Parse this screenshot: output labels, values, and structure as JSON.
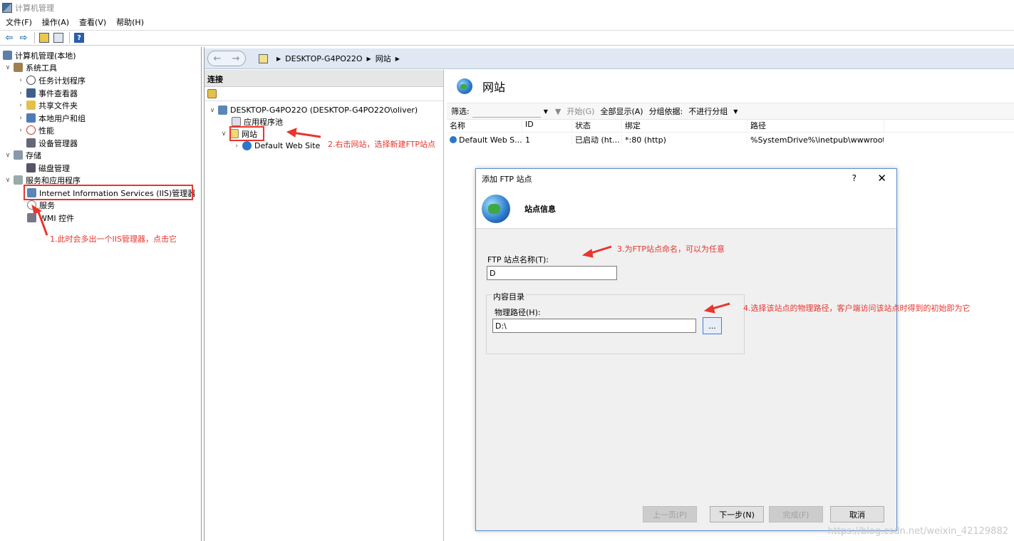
{
  "window": {
    "title": "计算机管理"
  },
  "menu": [
    "文件(F)",
    "操作(A)",
    "查看(V)",
    "帮助(H)"
  ],
  "left_tree": {
    "root": "计算机管理(本地)",
    "system_tools": "系统工具",
    "task_scheduler": "任务计划程序",
    "event_viewer": "事件查看器",
    "shared_folders": "共享文件夹",
    "local_users": "本地用户和组",
    "performance": "性能",
    "device_manager": "设备管理器",
    "storage": "存储",
    "disk_mgmt": "磁盘管理",
    "services_apps": "服务和应用程序",
    "iis_manager": "Internet Information Services (IIS)管理器",
    "services": "服务",
    "wmi": "WMI 控件"
  },
  "address": {
    "host": "DESKTOP-G4PO22O",
    "node": "网站"
  },
  "connections": {
    "title": "连接",
    "server": "DESKTOP-G4PO22O (DESKTOP-G4PO22O\\oliver)",
    "app_pools": "应用程序池",
    "sites": "网站",
    "default_site": "Default Web Site"
  },
  "sites_panel": {
    "title": "网站",
    "filter_label": "筛选:",
    "start_label": "开始(G)",
    "show_all": "全部显示(A)",
    "group_by_label": "分组依据:",
    "group_by_value": "不进行分组",
    "columns": [
      "名称",
      "ID",
      "状态",
      "绑定",
      "路径"
    ],
    "rows": [
      [
        "Default Web S...",
        "1",
        "已启动 (ht...",
        "*:80 (http)",
        "%SystemDrive%\\inetpub\\wwwroot"
      ]
    ]
  },
  "dialog": {
    "title": "添加 FTP 站点",
    "help": "?",
    "close": "✕",
    "banner_title": "站点信息",
    "site_name_label": "FTP 站点名称(T):",
    "site_name_value": "D",
    "content_dir_label": "内容目录",
    "phys_path_label": "物理路径(H):",
    "phys_path_value": "D:\\",
    "browse": "...",
    "prev": "上一页(P)",
    "next": "下一步(N)",
    "finish": "完成(F)",
    "cancel": "取消"
  },
  "annotations": {
    "a1": "1.此时会多出一个IIS管理器，点击它",
    "a2": "2.右击网站，选择新建FTP站点",
    "a3": "3.为FTP站点命名，可以为任意",
    "a4": "4.选择该站点的物理路径，客户端访问该站点时得到的初始即为它"
  },
  "watermark": "https://blog.csdn.net/weixin_42129882",
  "colors": {
    "annotation": "#e8352e",
    "accent": "#2b6fb6"
  }
}
